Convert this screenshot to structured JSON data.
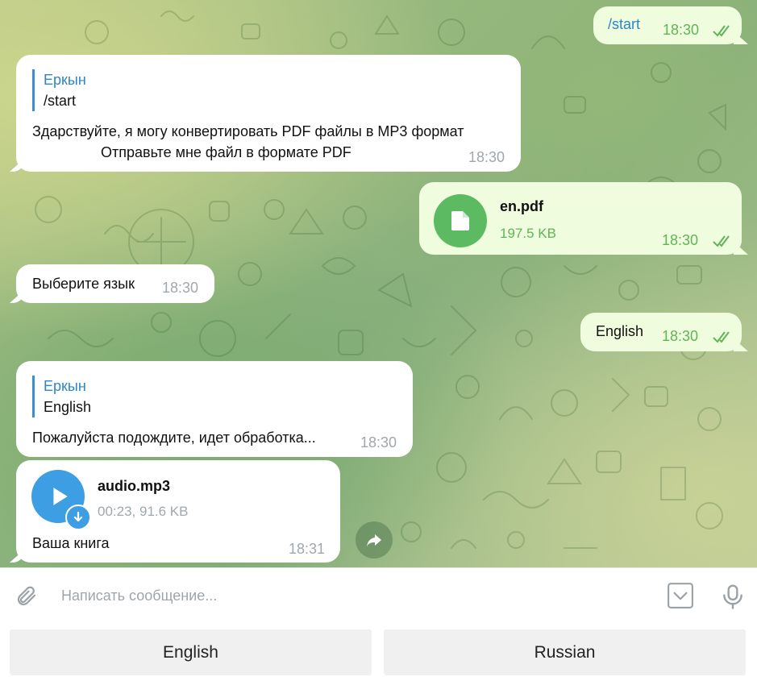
{
  "colors": {
    "outgoing_bubble": "#effdde",
    "incoming_bubble": "#ffffff",
    "accent_green": "#5fb555",
    "accent_blue": "#2d86c6",
    "file_icon_green": "#5cba62",
    "audio_icon_blue": "#3d9ee4"
  },
  "messages": {
    "m1": {
      "text": "/start",
      "time": "18:30"
    },
    "m2": {
      "reply_name": "Еркын",
      "reply_text": "/start",
      "line1": "Здарствуйте, я могу конвертировать PDF файлы в MP3 формат",
      "line2": "Отправьте мне файл в формате PDF",
      "time": "18:30"
    },
    "m3": {
      "file_name": "en.pdf",
      "file_size": "197.5 KB",
      "time": "18:30",
      "icon": "document-icon"
    },
    "m4": {
      "text": "Выберите язык",
      "time": "18:30"
    },
    "m5": {
      "text": "English",
      "time": "18:30"
    },
    "m6": {
      "reply_name": "Еркын",
      "reply_text": "English",
      "text": "Пожалуйста подождите, идет обработка...",
      "time": "18:30"
    },
    "m7": {
      "file_name": "audio.mp3",
      "file_meta": "00:23, 91.6 KB",
      "caption": "Ваша книга",
      "time": "18:31",
      "icon": "play-icon"
    }
  },
  "composer": {
    "placeholder": "Написать сообщение...",
    "attach_icon": "paperclip-icon",
    "keyboard_icon": "keyboard-toggle-icon",
    "mic_icon": "microphone-icon"
  },
  "keyboard": {
    "buttons": [
      "English",
      "Russian"
    ]
  }
}
